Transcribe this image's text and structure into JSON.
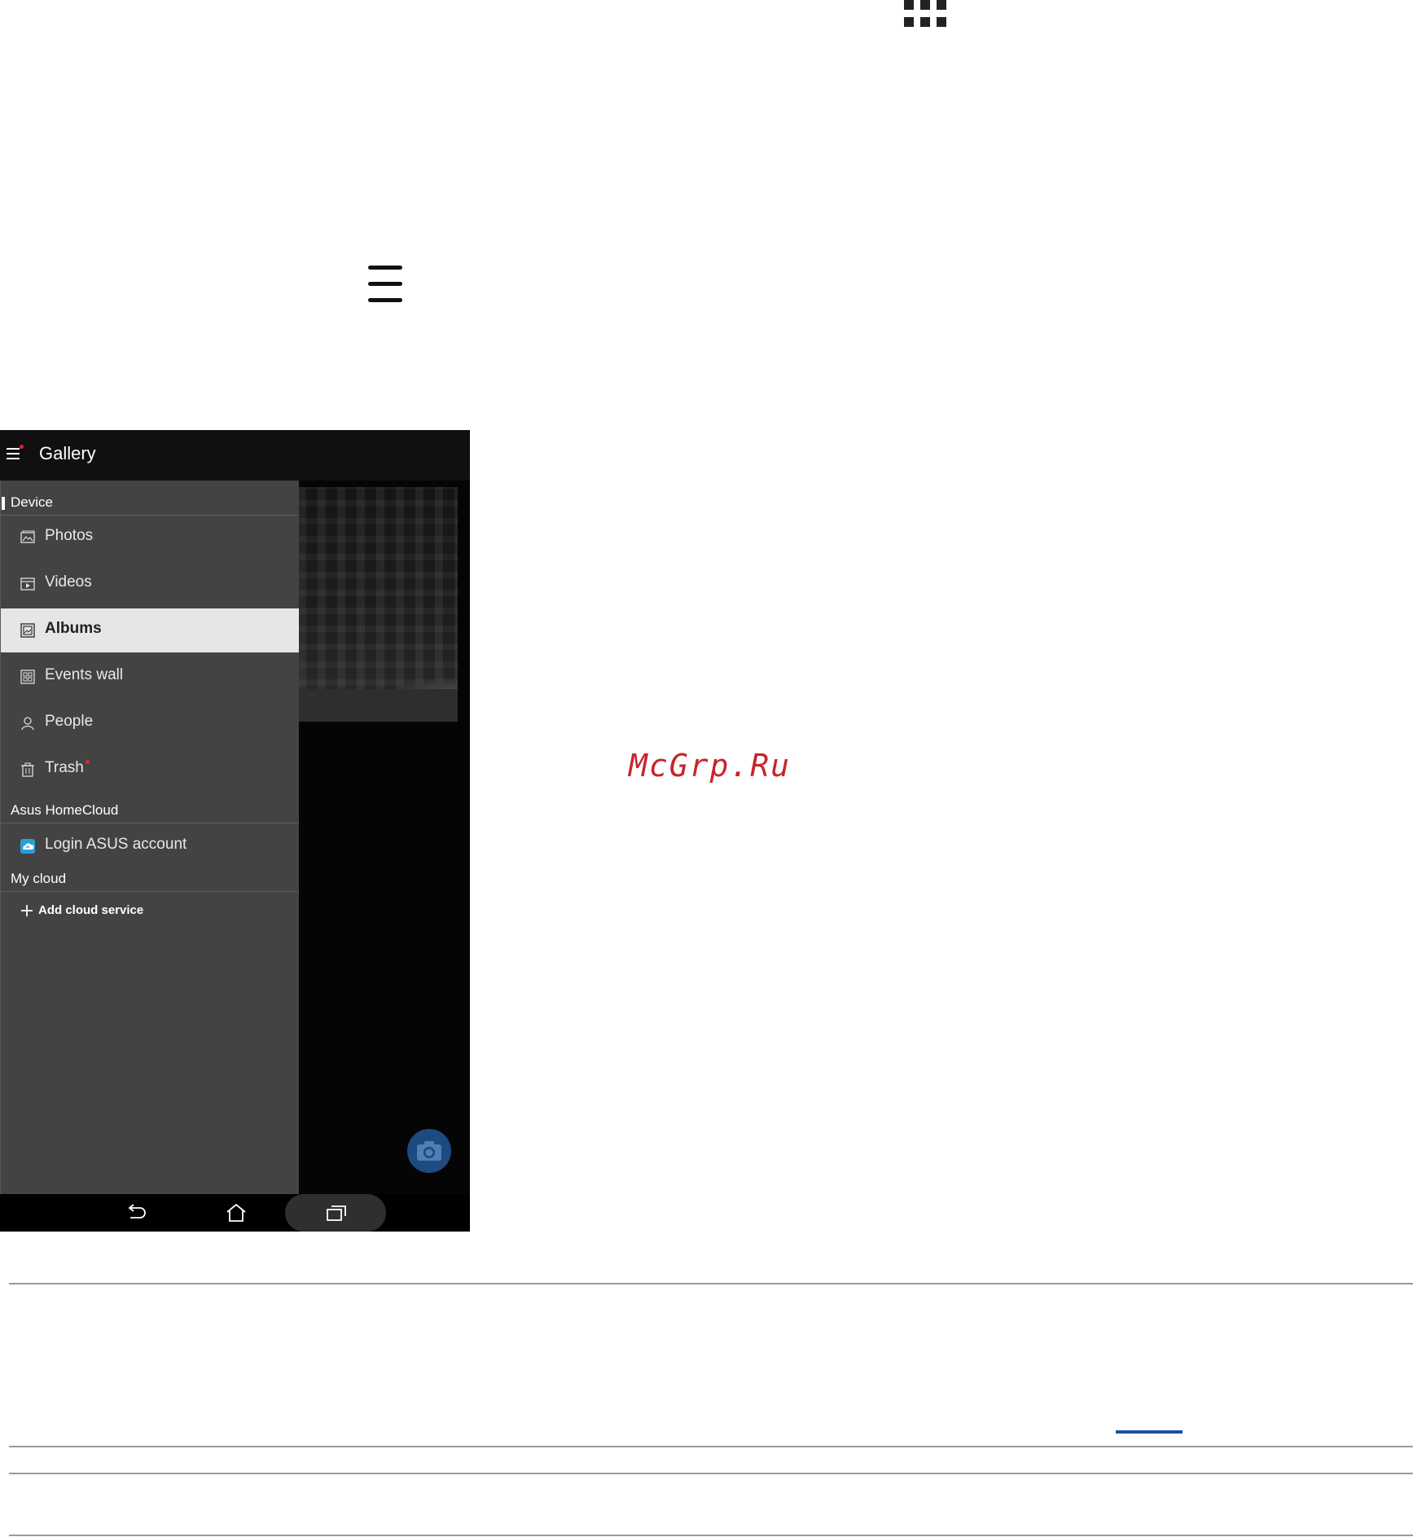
{
  "watermark": "McGrp.Ru",
  "app": {
    "title": "Gallery"
  },
  "drawer": {
    "sections": {
      "device": "Device",
      "homecloud": "Asus HomeCloud",
      "mycloud": "My cloud"
    },
    "items": [
      {
        "label": "Photos",
        "icon": "photos-icon"
      },
      {
        "label": "Videos",
        "icon": "videos-icon"
      },
      {
        "label": "Albums",
        "icon": "albums-icon",
        "selected": true
      },
      {
        "label": "Events wall",
        "icon": "events-wall-icon"
      },
      {
        "label": "People",
        "icon": "person-icon"
      },
      {
        "label": "Trash",
        "icon": "trash-icon",
        "badge": "red-dot"
      }
    ],
    "homecloud_item": {
      "label": "Login ASUS account",
      "icon": "asus-cloud-icon"
    },
    "add_cloud": {
      "label": "Add cloud service",
      "icon": "plus-icon"
    }
  },
  "navbar": {
    "buttons": [
      "back-icon",
      "home-icon",
      "recents-icon"
    ]
  },
  "colors": {
    "accent": "#c8242c",
    "drawer_bg": "#434343",
    "selected_bg": "#e6e6e6",
    "fab": "#1d4a80",
    "link": "#1f4fa5"
  }
}
